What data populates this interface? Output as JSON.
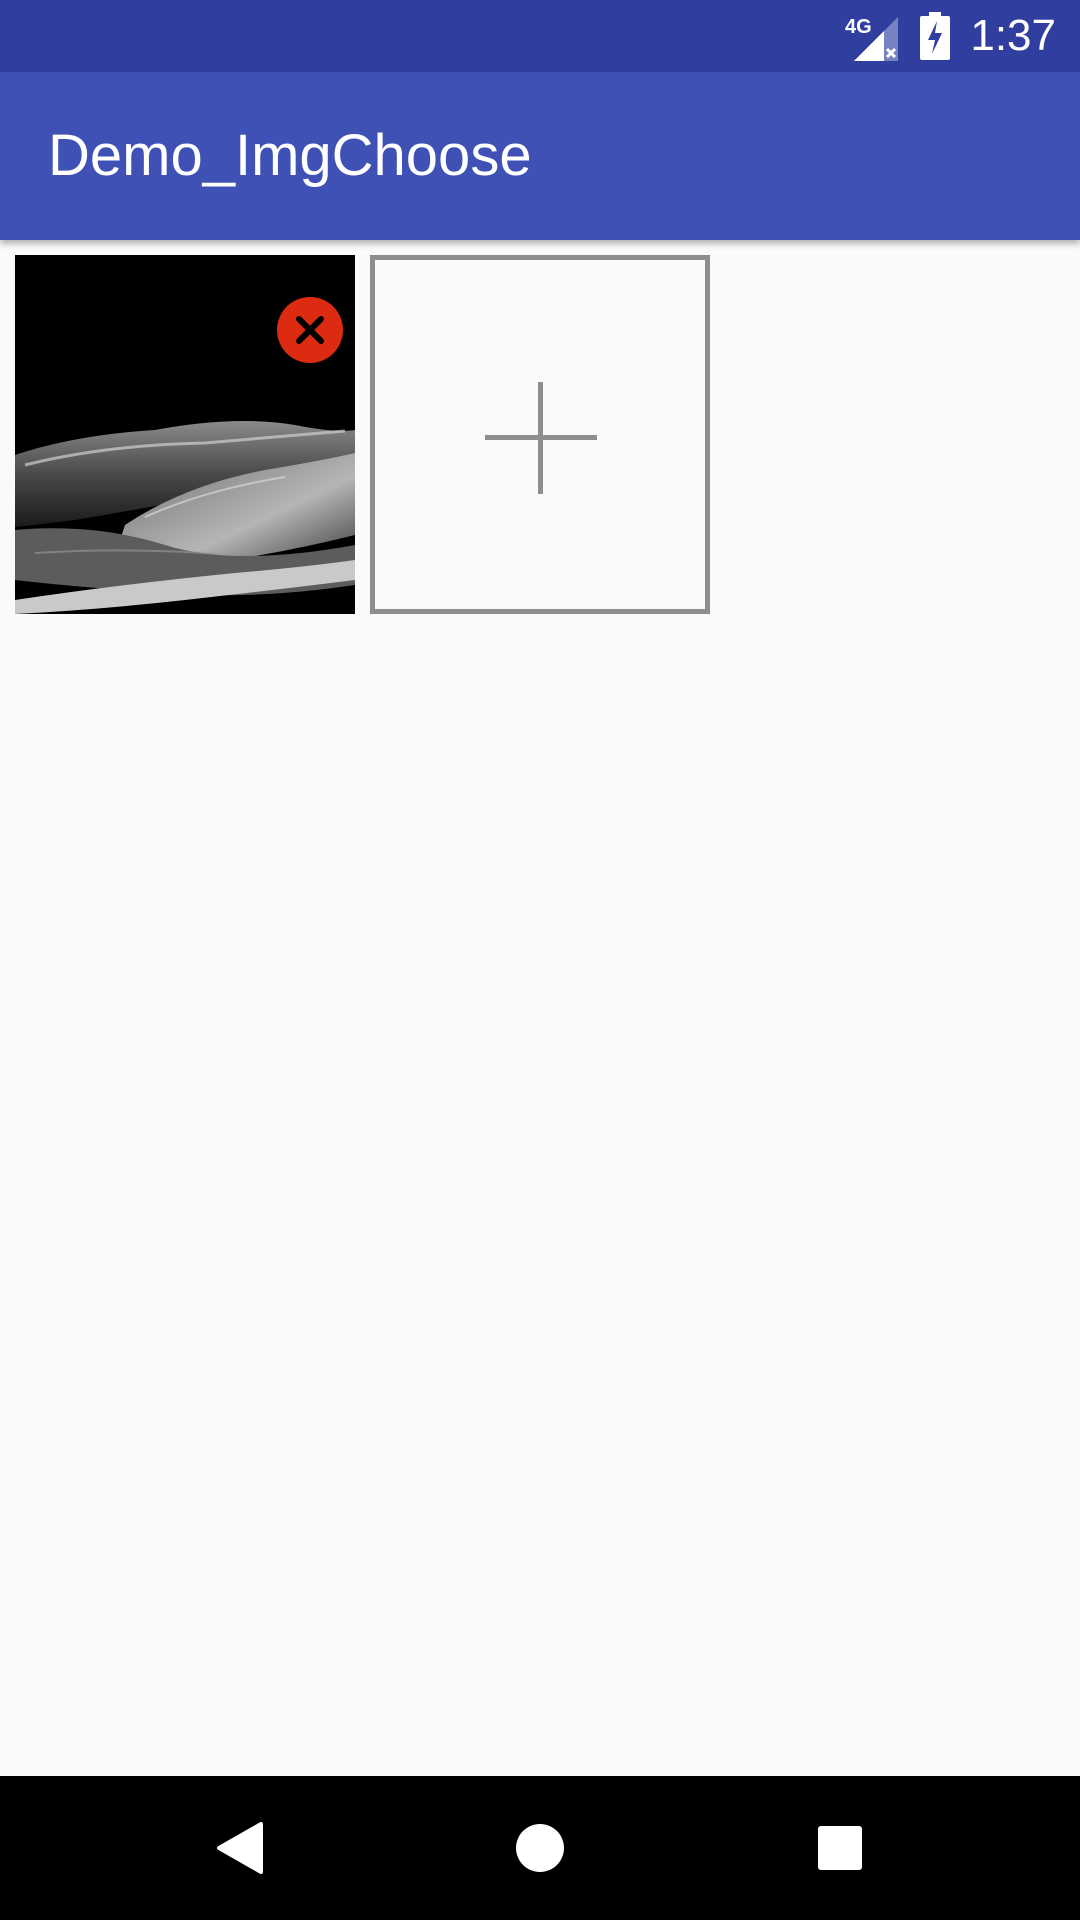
{
  "status_bar": {
    "network_label": "4G",
    "time": "1:37",
    "icons": [
      "signal-4g-icon",
      "battery-charging-icon"
    ]
  },
  "app_bar": {
    "title": "Demo_ImgChoose",
    "color": "#3f51b5",
    "status_color": "#303f9f"
  },
  "grid": {
    "items": [
      {
        "type": "image",
        "icon": "remove-icon",
        "accent": "#dd2b12"
      },
      {
        "type": "add",
        "icon": "plus-icon"
      }
    ]
  },
  "nav_bar": {
    "buttons": [
      "back-icon",
      "home-icon",
      "recents-icon"
    ]
  }
}
